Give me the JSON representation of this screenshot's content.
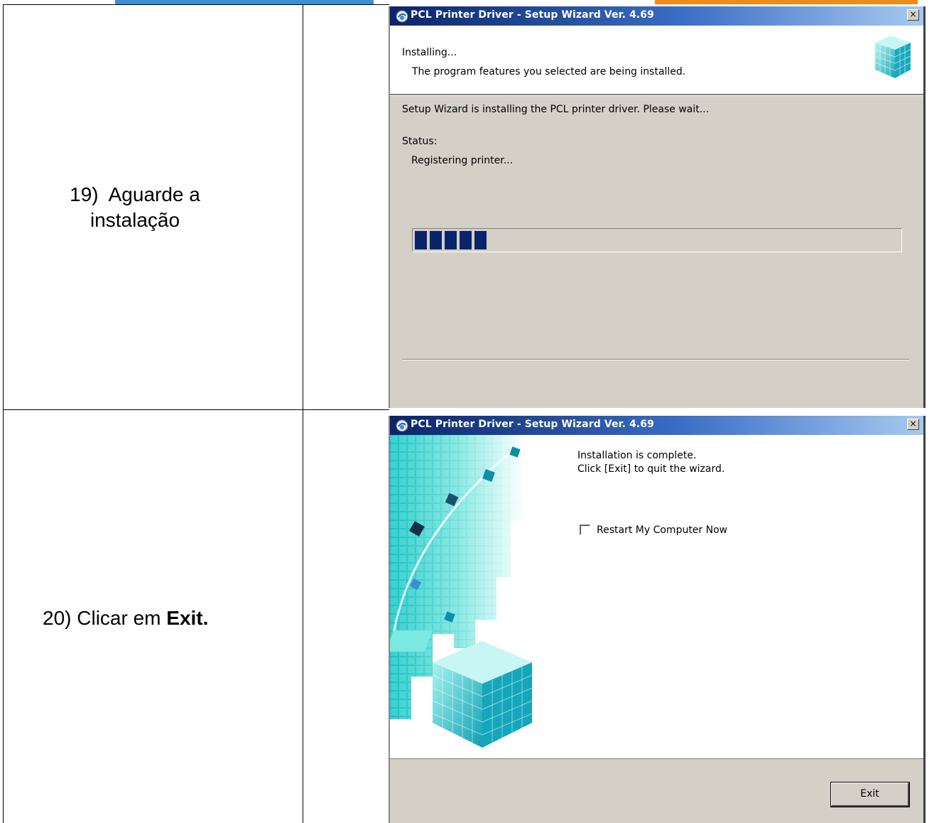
{
  "steps": [
    {
      "number": "19)",
      "text": "Aguarde a",
      "text2": "instalação"
    },
    {
      "number": "20)",
      "text": "Clicar em",
      "emphasis": "Exit."
    }
  ],
  "installing_window": {
    "title": "PCL Printer Driver - Setup Wizard Ver. 4.69",
    "close_glyph": "×",
    "header_title": "Installing...",
    "header_subtitle": "The program features you selected are being installed.",
    "message": "Setup Wizard is installing the PCL printer driver. Please wait...",
    "status_label": "Status:",
    "status_value": "Registering printer...",
    "progress": {
      "filled_blocks": 5,
      "fraction": 0.15
    }
  },
  "complete_window": {
    "title": "PCL Printer Driver - Setup Wizard Ver. 4.69",
    "close_glyph": "×",
    "message_line1": "Installation is complete.",
    "message_line2": "Click [Exit] to quit the wizard.",
    "restart_checkbox_label": "Restart My Computer Now",
    "restart_checked": false,
    "exit_button": "Exit"
  },
  "colors": {
    "title_gradient_start": "#0a246a",
    "title_gradient_end": "#a6caf0",
    "progress_fill": "#0a246a",
    "dialog_face": "#d4d0c8",
    "art_teal": "#1ec8c8"
  }
}
